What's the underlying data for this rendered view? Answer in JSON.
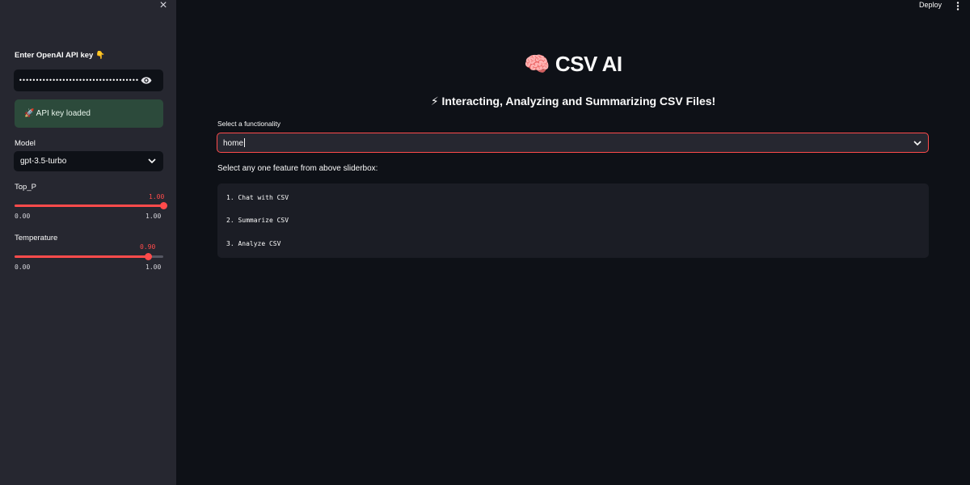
{
  "header": {
    "deploy_label": "Deploy",
    "menu_icon": "more-vert-icon"
  },
  "sidebar": {
    "close_icon": "×",
    "api_key": {
      "label": "Enter OpenAI API key 👇",
      "value": "••••••••••••••••••••••••••••••••••••••••••••••••••••",
      "toggle_icon": "eye-icon"
    },
    "status": {
      "text": "🚀 API key loaded",
      "color": "#2c4a3b"
    },
    "model": {
      "label": "Model",
      "selected": "gpt-3.5-turbo"
    },
    "top_p": {
      "label": "Top_P",
      "value": "1.00",
      "min": "0.00",
      "max": "1.00",
      "fraction": 1.0
    },
    "temperature": {
      "label": "Temperature",
      "value": "0.90",
      "min": "0.00",
      "max": "1.00",
      "fraction": 0.9
    }
  },
  "main": {
    "title": "🧠 CSV AI",
    "subtitle": "⚡ Interacting, Analyzing and Summarizing CSV Files!",
    "functionality": {
      "label": "Select a functionality",
      "selected": "home"
    },
    "instruction": "Select any one feature from above sliderbox:",
    "features": [
      "1. Chat with CSV",
      "2. Summarize CSV",
      "3. Analyze CSV"
    ]
  },
  "colors": {
    "accent": "#ff4b4b",
    "background": "#0e1117",
    "sidebar": "#262730"
  }
}
